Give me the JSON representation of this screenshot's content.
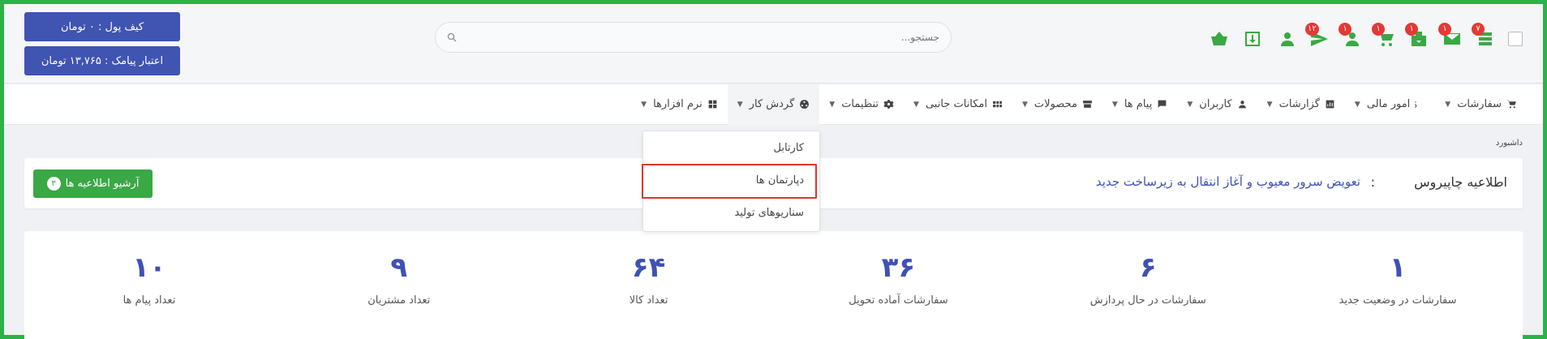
{
  "header": {
    "icons": [
      {
        "name": "menu-icon",
        "badge": "۷"
      },
      {
        "name": "mail-icon",
        "badge": "۱"
      },
      {
        "name": "gift-download-icon",
        "badge": "۱"
      },
      {
        "name": "cart-icon",
        "badge": "۱"
      },
      {
        "name": "user-icon",
        "badge": "۱"
      },
      {
        "name": "send-icon",
        "badge": "۱۲"
      },
      {
        "name": "add-user-icon",
        "badge": ""
      },
      {
        "name": "download-box-icon",
        "badge": ""
      },
      {
        "name": "basket-icon",
        "badge": ""
      }
    ],
    "search_placeholder": "جستجو...",
    "wallet_label": "کیف پول : ۰ تومان",
    "sms_credit_label": "اعتبار پیامک : ۱۳,۷۶۵ تومان"
  },
  "nav": {
    "items": [
      {
        "label": "سفارشات",
        "icon": "cart-icon"
      },
      {
        "label": "امور مالی",
        "icon": "dollar-icon"
      },
      {
        "label": "گزارشات",
        "icon": "report-icon"
      },
      {
        "label": "کاربران",
        "icon": "user-icon"
      },
      {
        "label": "پیام ها",
        "icon": "chat-icon"
      },
      {
        "label": "محصولات",
        "icon": "product-icon"
      },
      {
        "label": "امکانات جانبی",
        "icon": "grid-icon"
      },
      {
        "label": "تنظیمات",
        "icon": "gear-icon"
      },
      {
        "label": "گردش کار",
        "icon": "workflow-icon"
      },
      {
        "label": "نرم افزارها",
        "icon": "apps-icon"
      }
    ],
    "dropdown": [
      "کارتابل",
      "دپارتمان ها",
      "سناریوهای تولید"
    ]
  },
  "breadcrumb": "داشبورد",
  "announcement": {
    "title": "اطلاعیه چاپیروس",
    "separator": ":",
    "text": "تعویض سرور معیوب و آغاز انتقال به زیرساخت جدید",
    "archive_label": "آرشیو اطلاعیه ها",
    "archive_count": "۳"
  },
  "stats": [
    {
      "value": "۱",
      "label": "سفارشات در وضعیت جدید"
    },
    {
      "value": "۶",
      "label": "سفارشات در حال پردازش"
    },
    {
      "value": "۳۶",
      "label": "سفارشات آماده تحویل"
    },
    {
      "value": "۶۴",
      "label": "تعداد کالا"
    },
    {
      "value": "۹",
      "label": "تعداد مشتریان"
    },
    {
      "value": "۱۰",
      "label": "تعداد پیام ها"
    }
  ],
  "colors": {
    "accent": "#3f51b5",
    "green": "#3aa844",
    "danger": "#e53935",
    "frame": "#2bb34a"
  }
}
